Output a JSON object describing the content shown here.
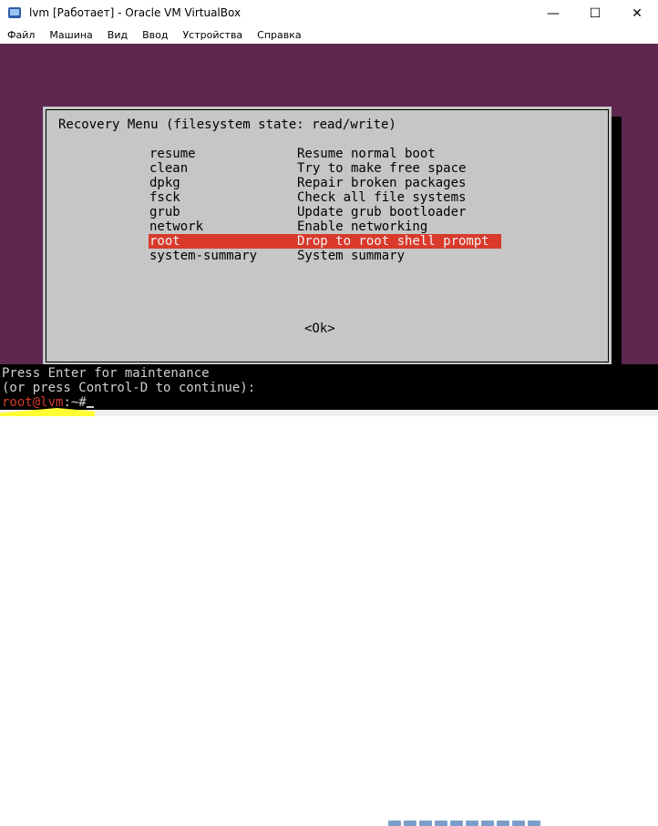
{
  "window": {
    "title": "lvm [Работает] - Oracle VM VirtualBox",
    "icon": "virtualbox-icon",
    "controls": {
      "minimize": "—",
      "maximize": "☐",
      "close": "✕"
    }
  },
  "menubar": {
    "items": [
      "Файл",
      "Машина",
      "Вид",
      "Ввод",
      "Устройства",
      "Справка"
    ]
  },
  "recovery_menu": {
    "title": "Recovery Menu (filesystem state: read/write)",
    "options": [
      {
        "name": "resume",
        "description": "Resume normal boot"
      },
      {
        "name": "clean",
        "description": "Try to make free space"
      },
      {
        "name": "dpkg",
        "description": "Repair broken packages"
      },
      {
        "name": "fsck",
        "description": "Check all file systems"
      },
      {
        "name": "grub",
        "description": "Update grub bootloader"
      },
      {
        "name": "network",
        "description": "Enable networking"
      },
      {
        "name": "root",
        "description": "Drop to root shell prompt"
      },
      {
        "name": "system-summary",
        "description": "System summary"
      }
    ],
    "selected": "root",
    "ok_label": "<Ok>"
  },
  "console": {
    "line1": "Press Enter for maintenance",
    "line2": "(or press Control-D to continue):",
    "prompt_user_host": "root@lvm",
    "prompt_rest": ":~#"
  },
  "colors": {
    "desktop": "#5e2750",
    "dialog": "#c6c6c6",
    "selection": "#d93a2b",
    "console_bg": "#000000",
    "highlighter": "#ffff33"
  }
}
